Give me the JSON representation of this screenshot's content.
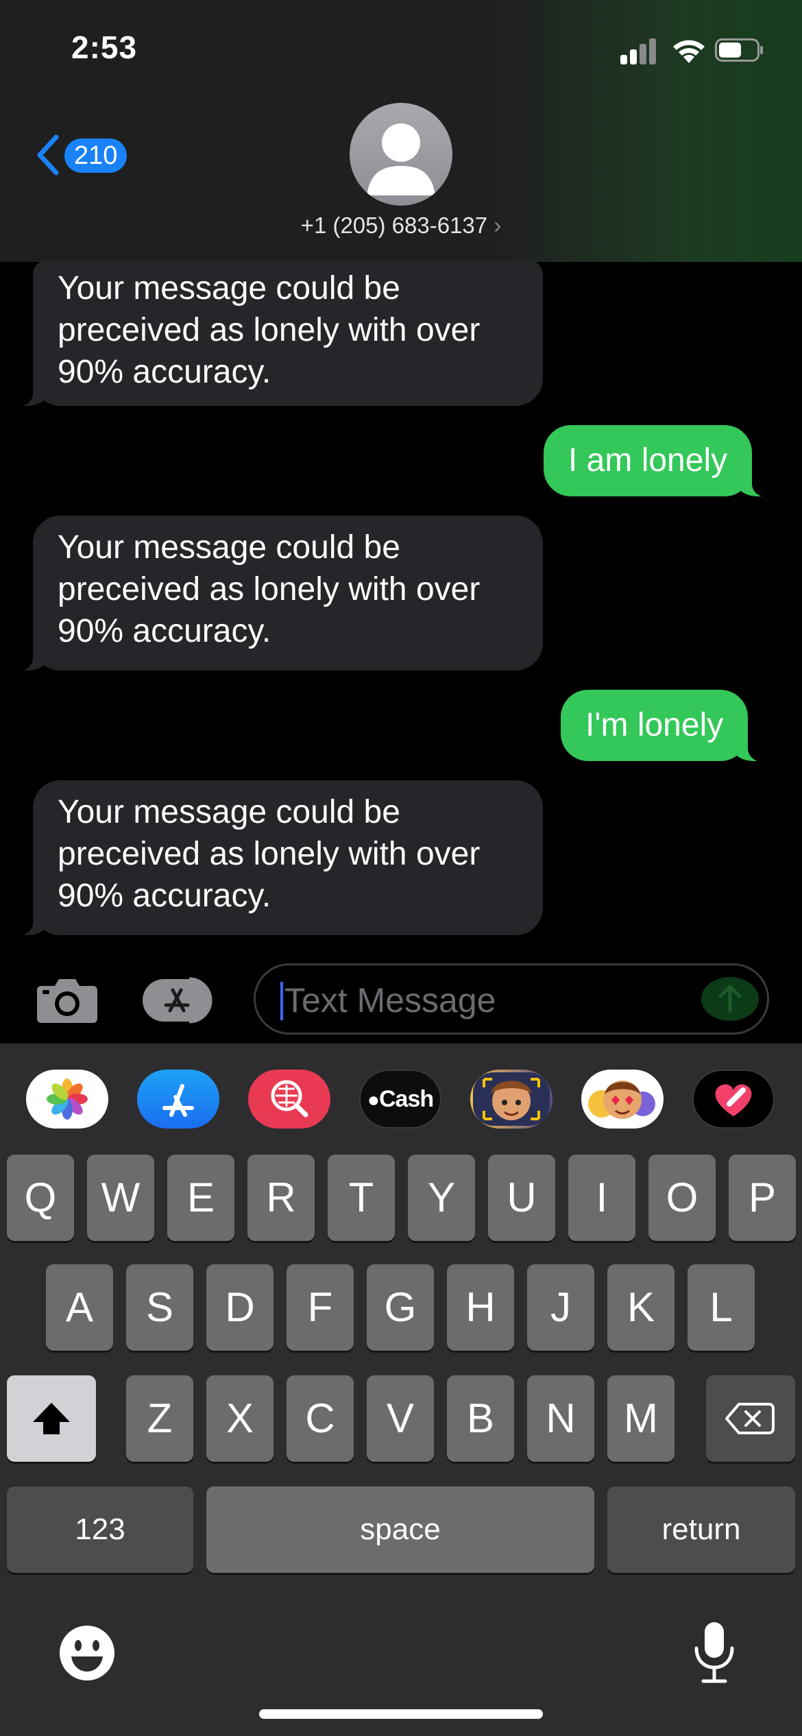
{
  "status": {
    "time": "2:53"
  },
  "header": {
    "back_count": "210",
    "contact_number": "+1 (205) 683-6137",
    "chevron": "›"
  },
  "messages": [
    {
      "type": "received",
      "text": "Your message could be preceived as lonely with over 90% accuracy."
    },
    {
      "type": "sent",
      "text": "I am lonely"
    },
    {
      "type": "received",
      "text": "Your message could be preceived as lonely with over 90% accuracy."
    },
    {
      "type": "sent",
      "text": "I'm lonely"
    },
    {
      "type": "received",
      "text": "Your message could be preceived as lonely with over 90% accuracy."
    }
  ],
  "input": {
    "placeholder": "Text Message"
  },
  "apps": [
    {
      "name": "photos-app-icon"
    },
    {
      "name": "app-store-icon"
    },
    {
      "name": "images-search-icon"
    },
    {
      "name": "apple-cash-icon",
      "label": "Cash"
    },
    {
      "name": "memoji-icon"
    },
    {
      "name": "memoji-stickers-icon"
    },
    {
      "name": "digital-touch-icon"
    }
  ],
  "keyboard": {
    "row1": [
      "Q",
      "W",
      "E",
      "R",
      "T",
      "Y",
      "U",
      "I",
      "O",
      "P"
    ],
    "row2": [
      "A",
      "S",
      "D",
      "F",
      "G",
      "H",
      "J",
      "K",
      "L"
    ],
    "row3": [
      "Z",
      "X",
      "C",
      "V",
      "B",
      "N",
      "M"
    ],
    "numbers_label": "123",
    "space_label": "space",
    "return_label": "return"
  },
  "colors": {
    "sent_bubble": "#34c759",
    "received_bubble": "#26252a",
    "badge": "#1a82f7"
  }
}
